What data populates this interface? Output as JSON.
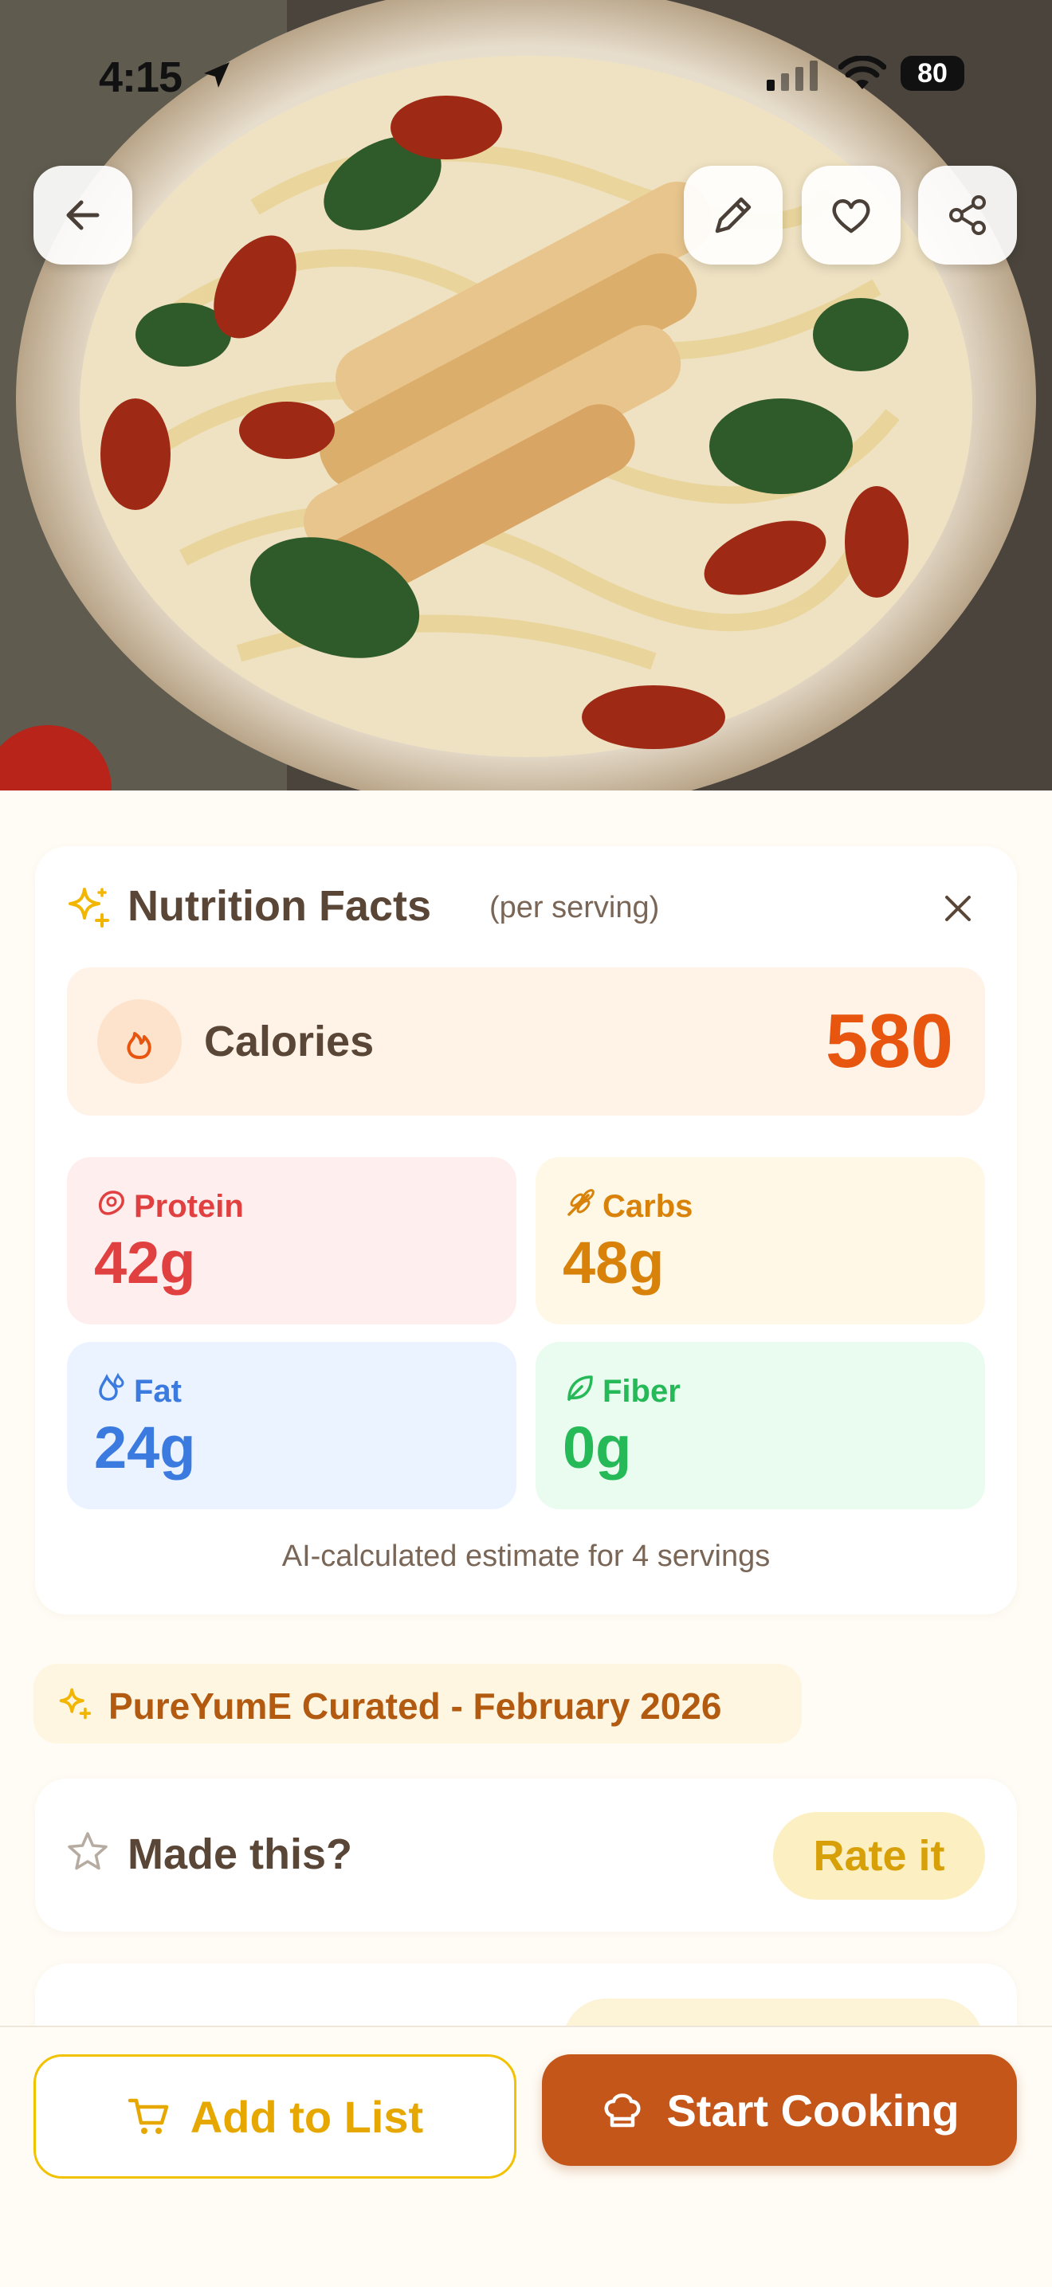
{
  "status_bar": {
    "time": "4:15",
    "battery": "80"
  },
  "hero": {
    "image_alt": "Creamy chicken pasta with spinach and sun-dried tomatoes",
    "buttons": [
      "back-icon",
      "edit-icon",
      "heart-icon",
      "share-icon"
    ]
  },
  "nutrition": {
    "title": "Nutrition Facts",
    "subtitle": "(per serving)",
    "calories_label": "Calories",
    "calories_value": "580",
    "macros": {
      "protein": {
        "label": "Protein",
        "value": "42g",
        "color": "#E14040"
      },
      "carbs": {
        "label": "Carbs",
        "value": "48g",
        "color": "#D8820A"
      },
      "fat": {
        "label": "Fat",
        "value": "24g",
        "color": "#3B7BE0"
      },
      "fiber": {
        "label": "Fiber",
        "value": "0g",
        "color": "#25B957"
      }
    },
    "note": "AI-calculated estimate for 4 servings"
  },
  "curated": {
    "text": "PureYumE Curated - February 2026"
  },
  "made_this": {
    "title": "Made this?",
    "rate_label": "Rate it"
  },
  "bottom_bar": {
    "add_label": "Add to List",
    "start_label": "Start Cooking"
  },
  "colors": {
    "accent": "#C4561A",
    "calories": "#E8550F",
    "yellow": "#F2C200"
  }
}
